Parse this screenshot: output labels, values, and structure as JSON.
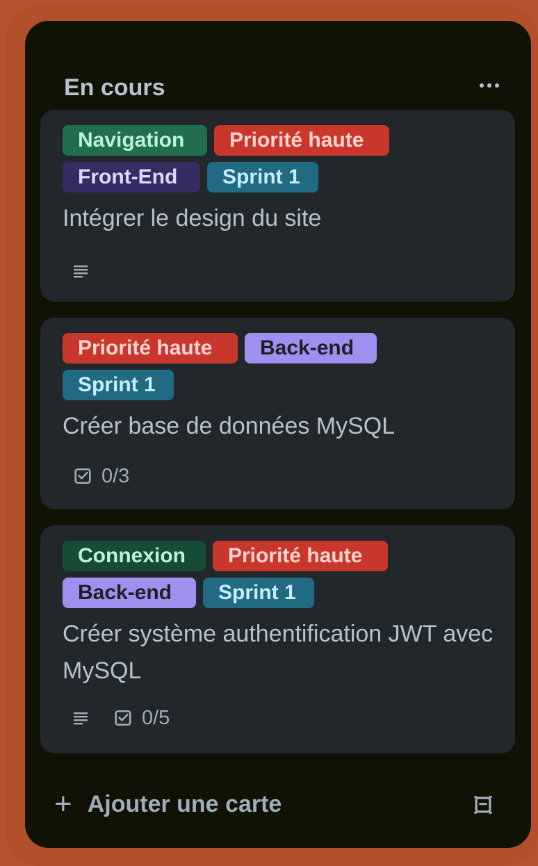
{
  "list": {
    "title": "En cours",
    "more_icon": "ellipsis-icon",
    "add_card_label": "Ajouter une carte",
    "template_icon": "card-template-icon"
  },
  "colors": {
    "frame": "#b1502a",
    "list_bg": "#101204",
    "card_bg": "#22272b",
    "green": "#1f845a",
    "green_dark": "#216e4e",
    "red": "#c9372c",
    "purple_dark": "#352c63",
    "purple_light": "#9f8fef",
    "teal": "#227d9b"
  },
  "cards": [
    {
      "labels": [
        "Navigation",
        "Priorité haute",
        "Front-End",
        "Sprint 1"
      ],
      "title": "Intégrer le design du site",
      "badges": {
        "description_icon": "description-icon"
      }
    },
    {
      "labels": [
        "Priorité haute",
        "Back-end",
        "Sprint 1"
      ],
      "title": "Créer base de données MySQL",
      "badges": {
        "checklist_icon": "checklist-icon",
        "checklist": "0/3"
      }
    },
    {
      "labels": [
        "Connexion",
        "Priorité haute",
        "Back-end",
        "Sprint 1"
      ],
      "title": "Créer système authentification JWT avec MySQL",
      "badges": {
        "description_icon": "description-icon",
        "checklist_icon": "checklist-icon",
        "checklist": "0/5"
      }
    }
  ]
}
